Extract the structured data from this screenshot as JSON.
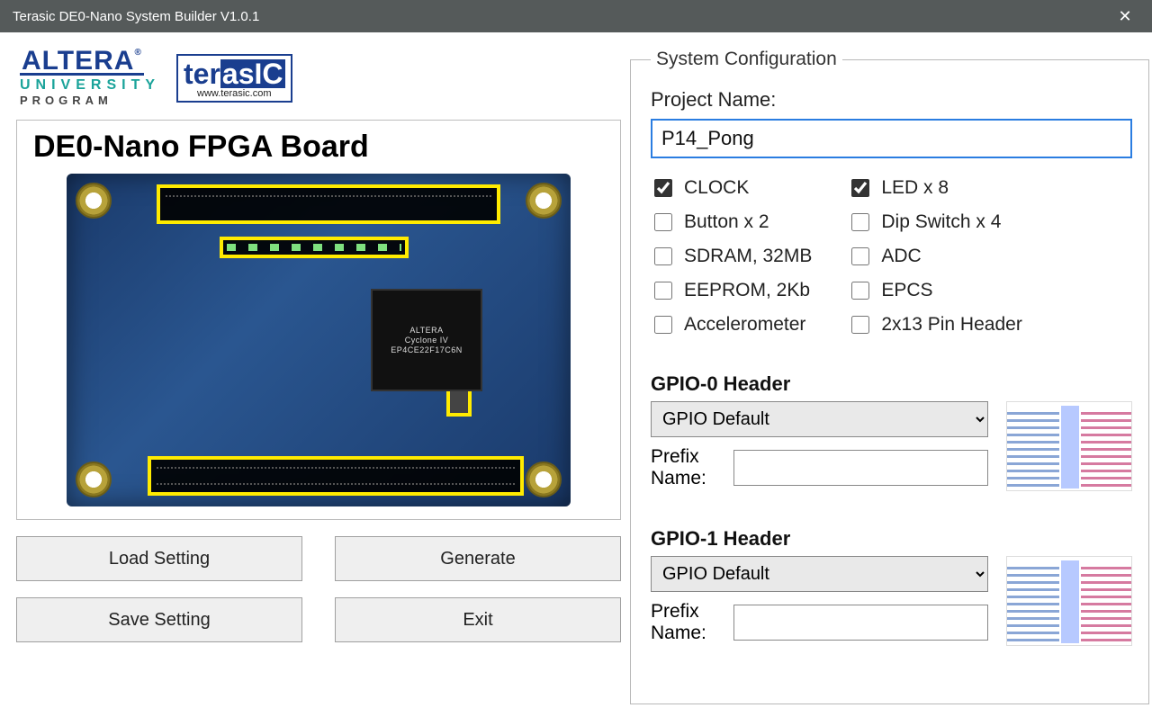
{
  "window": {
    "title": "Terasic DE0-Nano System Builder V1.0.1"
  },
  "logos": {
    "altera_top": "ALTERA",
    "altera_university": "UNIVERSITY",
    "altera_program": "PROGRAM",
    "terasic_ter": "ter",
    "terasic_asic": "asIC",
    "terasic_url": "www.terasic.com"
  },
  "board": {
    "title": "DE0-Nano FPGA Board",
    "chip_lines": [
      "ALTERA",
      "Cyclone IV",
      "EP4CE22F17C6N"
    ]
  },
  "buttons": {
    "load": "Load Setting",
    "generate": "Generate",
    "save": "Save Setting",
    "exit": "Exit"
  },
  "config": {
    "legend": "System Configuration",
    "project_label": "Project Name:",
    "project_value": "P14_Pong",
    "checks_left": [
      {
        "label": "CLOCK",
        "checked": true
      },
      {
        "label": "Button x 2",
        "checked": false
      },
      {
        "label": "SDRAM, 32MB",
        "checked": false
      },
      {
        "label": "EEPROM, 2Kb",
        "checked": false
      },
      {
        "label": "Accelerometer",
        "checked": false
      }
    ],
    "checks_right": [
      {
        "label": "LED x 8",
        "checked": true
      },
      {
        "label": "Dip Switch x 4",
        "checked": false
      },
      {
        "label": "ADC",
        "checked": false
      },
      {
        "label": "EPCS",
        "checked": false
      },
      {
        "label": "2x13 Pin Header",
        "checked": false
      }
    ],
    "gpio0": {
      "title": "GPIO-0 Header",
      "select_value": "GPIO Default",
      "prefix_label": "Prefix Name:",
      "prefix_value": ""
    },
    "gpio1": {
      "title": "GPIO-1 Header",
      "select_value": "GPIO Default",
      "prefix_label": "Prefix Name:",
      "prefix_value": ""
    }
  }
}
